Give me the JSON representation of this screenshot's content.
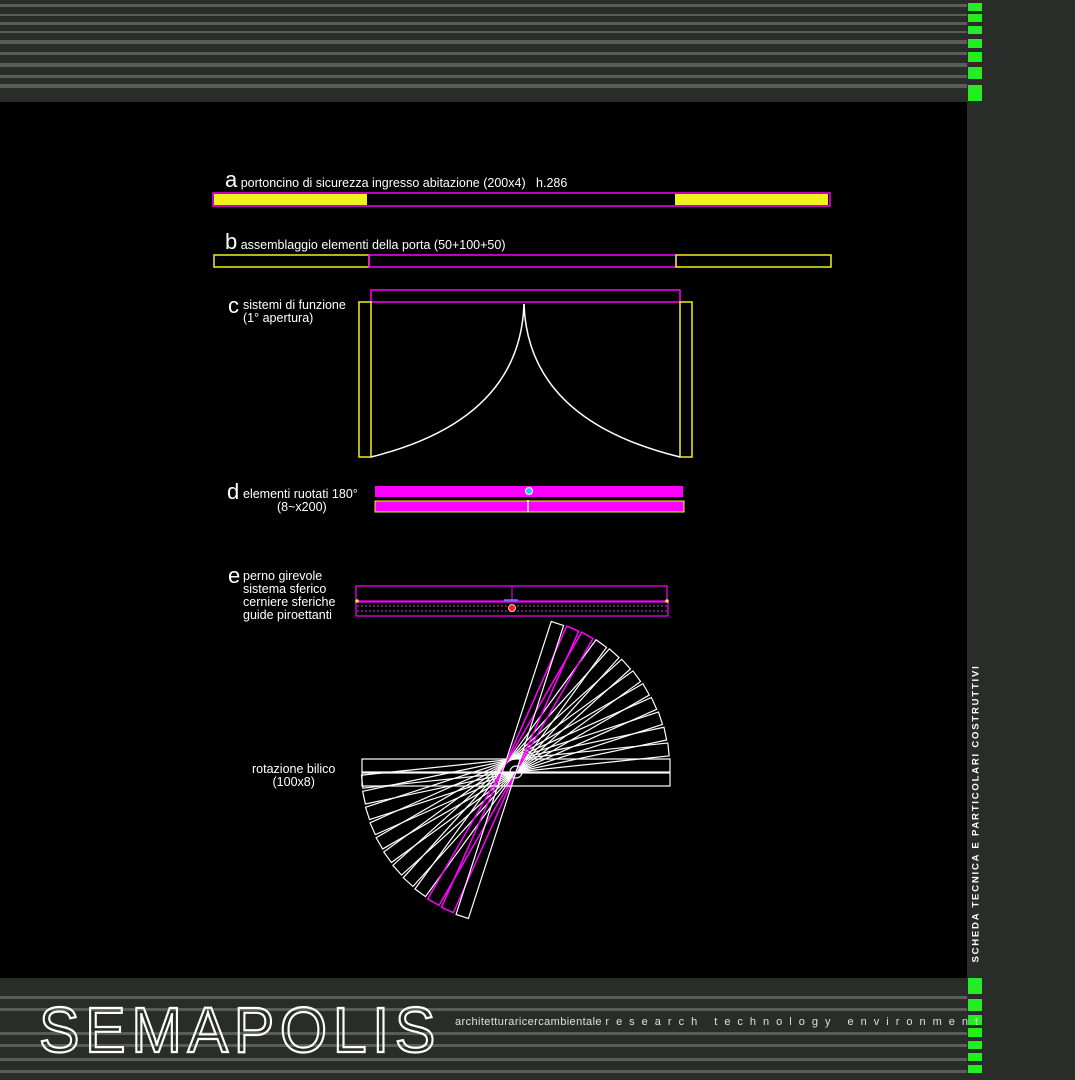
{
  "sections": {
    "a": {
      "letter": "a",
      "text": "portoncino di sicurezza ingresso abitazione (200x4)   h.286"
    },
    "b": {
      "letter": "b",
      "text": "assemblaggio elementi della porta (50+100+50)"
    },
    "c": {
      "letter": "c",
      "lines": [
        "sistemi di funzione",
        "(1° apertura)"
      ]
    },
    "d": {
      "letter": "d",
      "lines": [
        "elementi ruotati 180°",
        "(8~x200)"
      ]
    },
    "e": {
      "letter": "e",
      "lines": [
        "perno girevole",
        "sistema sferico",
        "cerniere sferiche",
        "guide piroettanti"
      ]
    },
    "f": {
      "lines": [
        "rotazione bilico",
        "(100x8)"
      ]
    }
  },
  "sidebar_title": "SCHEDA TECNICA E PARTICOLARI COSTRUTTIVI",
  "footer": {
    "tagline_a": "architetturaricercambientale",
    "tagline_b": "research technology environment"
  },
  "logo_text": "SEMAPOLIS",
  "colors": {
    "background": "#000000",
    "panel": "#2a2c2a",
    "stripe": "#5a5c5a",
    "magenta": "#ff00ff",
    "yellow": "#f0f020",
    "green": "#22ee22",
    "line": "#ffffff"
  },
  "diagram": {
    "rotation_angles_deg": [
      0,
      -6,
      -12,
      -18,
      -24,
      -30,
      -36,
      -42,
      -48,
      -54,
      -60,
      -66,
      -72
    ],
    "magenta_angles_deg": [
      -60,
      -66
    ]
  }
}
